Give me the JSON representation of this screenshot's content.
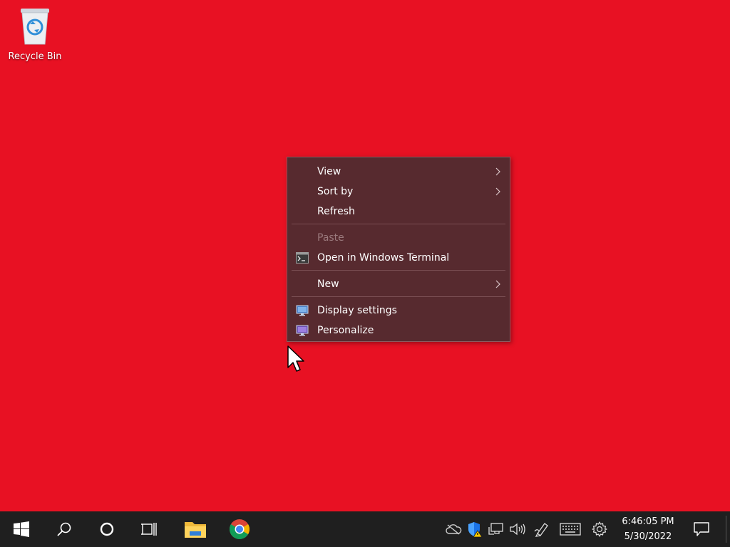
{
  "desktop": {
    "background_color": "#e81123",
    "icons": [
      {
        "label": "Recycle Bin",
        "icon": "recycle-bin-icon"
      }
    ]
  },
  "context_menu": {
    "items": [
      {
        "label": "View",
        "submenu": true
      },
      {
        "label": "Sort by",
        "submenu": true
      },
      {
        "label": "Refresh"
      },
      {
        "label": "Paste",
        "disabled": true
      },
      {
        "label": "Open in Windows Terminal",
        "icon": "terminal-icon"
      },
      {
        "label": "New",
        "submenu": true
      },
      {
        "label": "Display settings",
        "icon": "display-icon"
      },
      {
        "label": "Personalize",
        "icon": "personalize-icon"
      }
    ]
  },
  "taskbar": {
    "buttons": [
      {
        "name": "start",
        "icon": "windows-logo-icon"
      },
      {
        "name": "search",
        "icon": "search-icon"
      },
      {
        "name": "cortana",
        "icon": "cortana-icon"
      },
      {
        "name": "task-view",
        "icon": "task-view-icon"
      },
      {
        "name": "file-explorer",
        "icon": "folder-icon"
      },
      {
        "name": "chrome",
        "icon": "chrome-icon"
      }
    ],
    "tray_icons": [
      "onedrive-icon",
      "defender-icon",
      "network-icon",
      "volume-icon",
      "pen-icon",
      "keyboard-icon",
      "settings-gear-icon"
    ],
    "clock": {
      "time": "6:46:05 PM",
      "date": "5/30/2022"
    },
    "notification_icon": "action-center-icon"
  }
}
